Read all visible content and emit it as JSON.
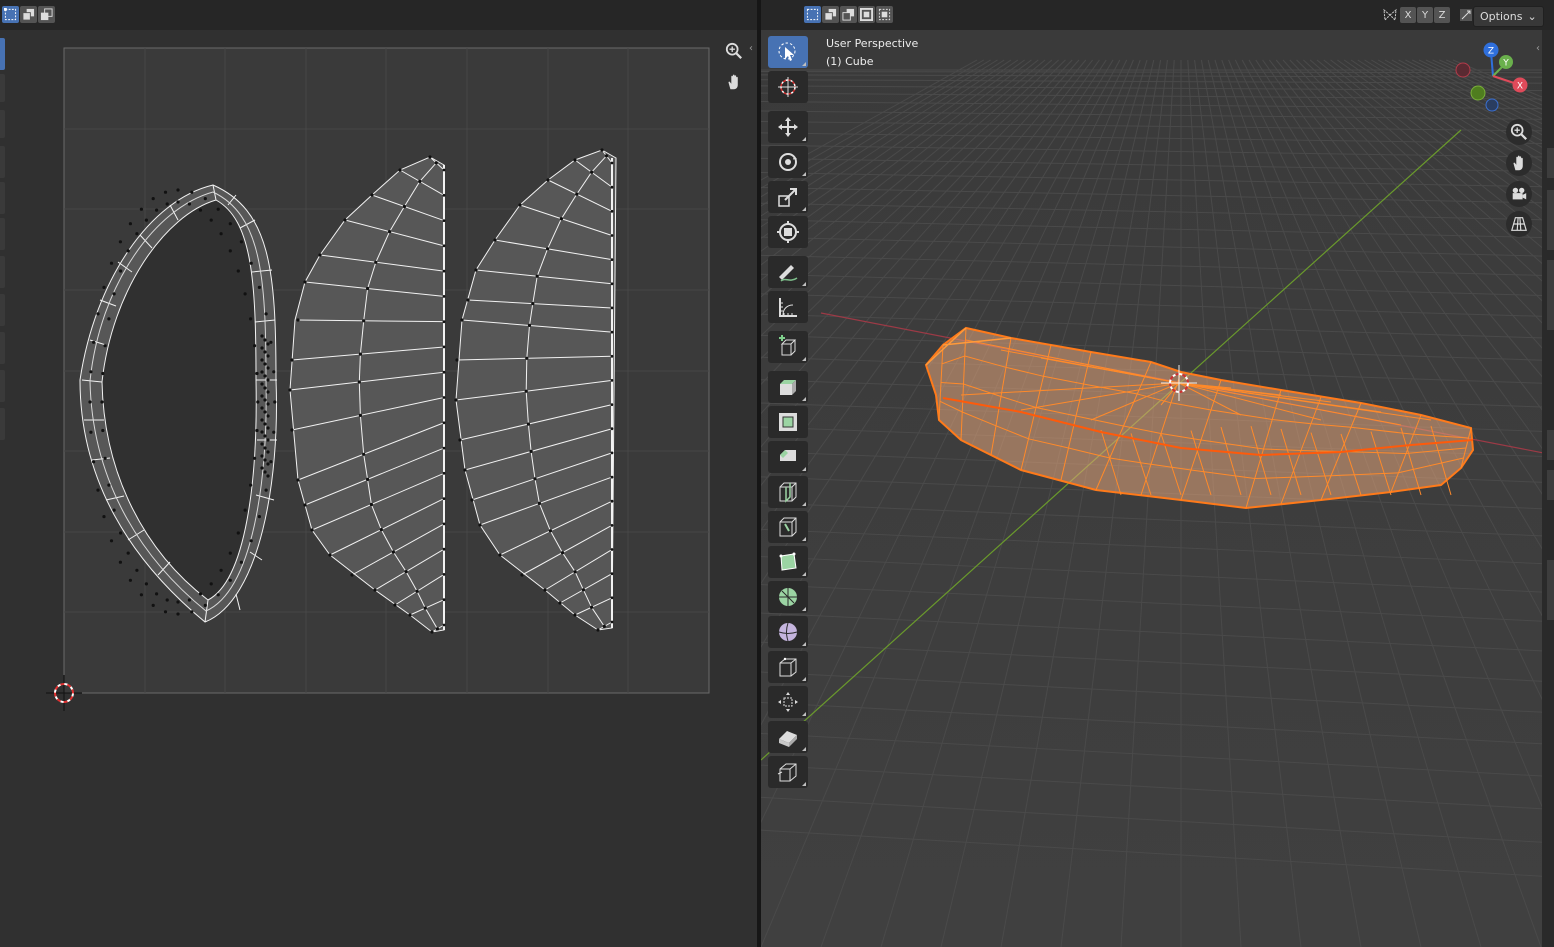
{
  "uv_editor": {
    "select_modes": [
      "vertex-select-mode",
      "edge-select-mode",
      "face-select-mode"
    ],
    "icons": [
      "zoom-icon",
      "hand-pan-icon",
      "cursor-crosshair-icon"
    ]
  },
  "viewport": {
    "select_modes": [
      "new-selection-mode",
      "extend-selection-mode",
      "subtract-selection-mode",
      "invert-selection-mode",
      "intersect-selection-mode"
    ],
    "view_label": "User Perspective",
    "object_label": "(1) Cube",
    "mirror_axes": [
      "X",
      "Y",
      "Z"
    ],
    "options_label": "Options",
    "gizmo": {
      "z": "Z",
      "y": "Y",
      "x": "X"
    },
    "tools": [
      "select-box-icon",
      "cursor-icon",
      "move-icon",
      "rotate-icon",
      "scale-icon",
      "transform-icon",
      "annotate-icon",
      "measure-icon",
      "add-cube-icon",
      "extrude-region-icon",
      "inset-faces-icon",
      "bevel-icon",
      "loop-cut-icon",
      "knife-icon",
      "poly-build-icon",
      "spin-icon",
      "smooth-icon",
      "edge-slide-icon",
      "shrink-fatten-icon",
      "shear-icon",
      "rip-region-icon"
    ],
    "nav_icons": [
      "zoom-icon",
      "hand-pan-icon",
      "camera-icon",
      "grid-ortho-icon"
    ]
  },
  "colors": {
    "selection_orange": "#ff7a1a",
    "active_blue": "#4772b3",
    "x_axis": "#b33b4a",
    "y_axis": "#6b9a2e"
  }
}
